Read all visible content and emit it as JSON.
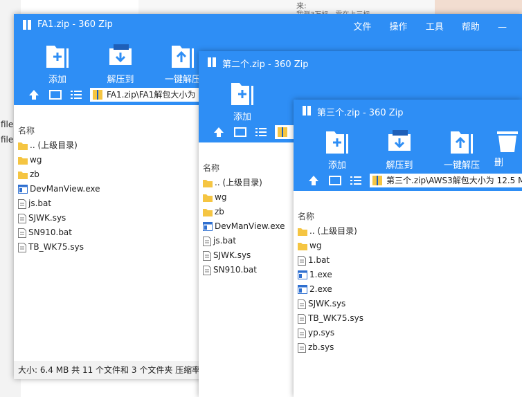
{
  "background": {
    "left_text": [
      "file",
      "file"
    ],
    "top_text": [
      "来:",
      "我测3万标，需在上三标"
    ]
  },
  "windows": [
    {
      "title": "FA1.zip - 360 Zip",
      "menus": [
        "文件",
        "操作",
        "工具",
        "帮助",
        "—"
      ],
      "toolbar": [
        "添加",
        "解压到",
        "一键解压"
      ],
      "address": "FA1.zip\\FA1解包大小为",
      "column_header": "名称",
      "items": [
        {
          "name": ".. (上级目录)",
          "icon": "folder-icon"
        },
        {
          "name": "wg",
          "icon": "folder-icon"
        },
        {
          "name": "zb",
          "icon": "folder-icon"
        },
        {
          "name": "DevManView.exe",
          "icon": "exe-icon"
        },
        {
          "name": "js.bat",
          "icon": "file-icon"
        },
        {
          "name": "SJWK.sys",
          "icon": "file-icon"
        },
        {
          "name": "SN910.bat",
          "icon": "file-icon"
        },
        {
          "name": "TB_WK75.sys",
          "icon": "file-icon"
        }
      ],
      "status": "大小: 6.4 MB 共 11 个文件和 3 个文件夹 压缩率"
    },
    {
      "title": "第二个.zip - 360 Zip",
      "toolbar": [
        "添加"
      ],
      "column_header": "名称",
      "items": [
        {
          "name": ".. (上级目录)",
          "icon": "folder-icon"
        },
        {
          "name": "wg",
          "icon": "folder-icon"
        },
        {
          "name": "zb",
          "icon": "folder-icon"
        },
        {
          "name": "DevManView.exe",
          "icon": "exe-icon"
        },
        {
          "name": "js.bat",
          "icon": "file-icon"
        },
        {
          "name": "SJWK.sys",
          "icon": "file-icon"
        },
        {
          "name": "SN910.bat",
          "icon": "file-icon"
        }
      ]
    },
    {
      "title": "第三个.zip - 360 Zip",
      "toolbar": [
        "添加",
        "解压到",
        "一键解压",
        "删"
      ],
      "address": "第三个.zip\\AWS3解包大小为 12.5 M",
      "column_header": "名称",
      "items": [
        {
          "name": ".. (上级目录)",
          "icon": "folder-icon"
        },
        {
          "name": "wg",
          "icon": "folder-icon"
        },
        {
          "name": "1.bat",
          "icon": "file-icon"
        },
        {
          "name": "1.exe",
          "icon": "exe-icon"
        },
        {
          "name": "2.exe",
          "icon": "exe-icon"
        },
        {
          "name": "SJWK.sys",
          "icon": "file-icon"
        },
        {
          "name": "TB_WK75.sys",
          "icon": "file-icon"
        },
        {
          "name": "yp.sys",
          "icon": "file-icon"
        },
        {
          "name": "zb.sys",
          "icon": "file-icon"
        }
      ]
    }
  ],
  "colors": {
    "accent": "#2e8ef5",
    "folder": "#f5c542",
    "status_bg": "#f2f2f2"
  }
}
